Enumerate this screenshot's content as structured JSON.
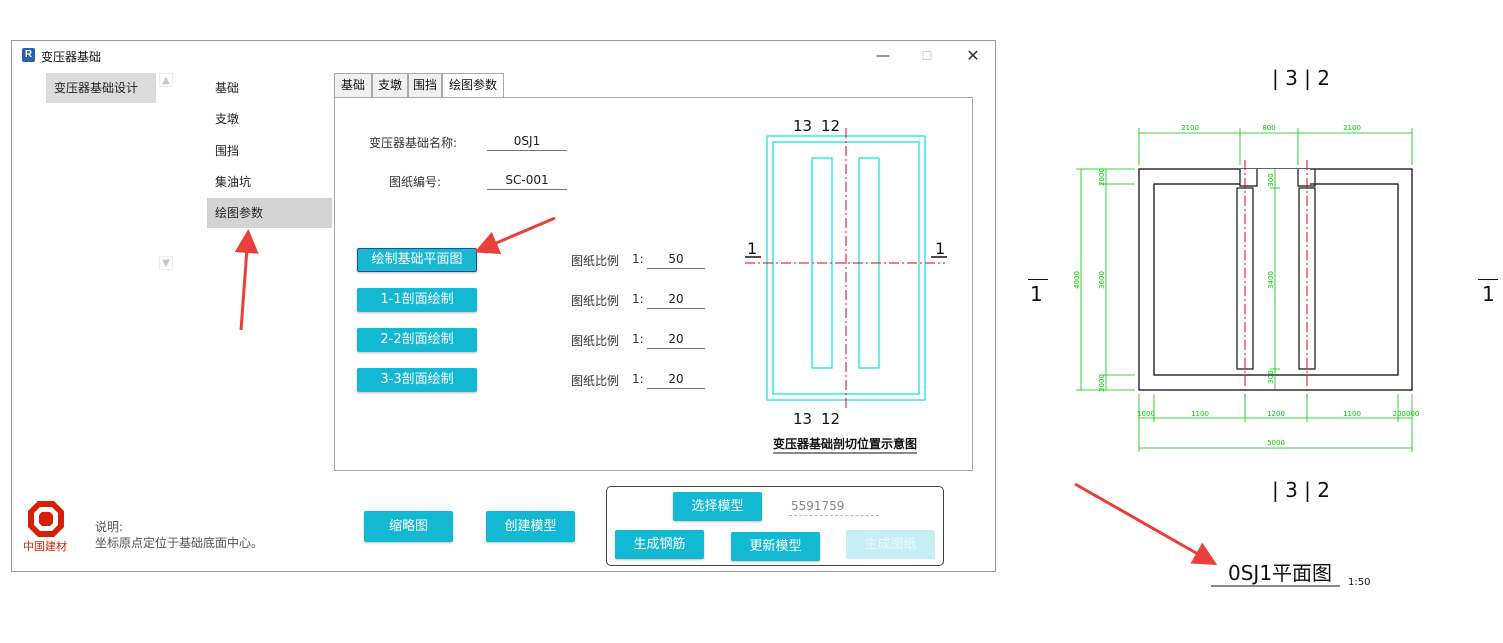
{
  "window": {
    "title": "变压器基础",
    "app_icon": "R",
    "controls": {
      "minimize": "—",
      "maximize": "☐",
      "close": "✕"
    }
  },
  "tree": {
    "item": "变压器基础设计",
    "scroll_up": "▲",
    "scroll_down": "▼"
  },
  "nav": {
    "items": [
      {
        "label": "基础"
      },
      {
        "label": "支墩"
      },
      {
        "label": "围挡"
      },
      {
        "label": "集油坑"
      },
      {
        "label": "绘图参数"
      }
    ],
    "active": 4
  },
  "tabs": [
    {
      "label": "基础"
    },
    {
      "label": "支墩"
    },
    {
      "label": "围挡"
    },
    {
      "label": "绘图参数"
    }
  ],
  "form": {
    "name_label": "变压器基础名称:",
    "name_value": "0SJ1",
    "number_label": "图纸编号:",
    "number_value": "SC-001"
  },
  "draw_rows": [
    {
      "button": "绘制基础平面图",
      "scale_label": "图纸比例",
      "prefix": "1:",
      "value": "50"
    },
    {
      "button": "1-1剖面绘制",
      "scale_label": "图纸比例",
      "prefix": "1:",
      "value": "20"
    },
    {
      "button": "2-2剖面绘制",
      "scale_label": "图纸比例",
      "prefix": "1:",
      "value": "20"
    },
    {
      "button": "3-3剖面绘制",
      "scale_label": "图纸比例",
      "prefix": "1:",
      "value": "20"
    }
  ],
  "preview": {
    "top_labels": [
      "13",
      "12"
    ],
    "bottom_labels": [
      "13",
      "12"
    ],
    "left_label": "1",
    "right_label": "1",
    "caption": "变压器基础剖切位置示意图"
  },
  "bottom": {
    "thumbnail_button": "缩略图",
    "create_model_button": "创建模型",
    "select_model_button": "选择模型",
    "model_id": "5591759",
    "rebar_button": "生成钢筋",
    "update_model_button": "更新模型",
    "drawing_button": "生成图纸"
  },
  "logo_text": "中国建材",
  "note": {
    "title": "说明:",
    "text": "坐标原点定位于基础底面中心。"
  },
  "drawing": {
    "section_top": "| 3 | 2",
    "section_bottom": "| 3 | 2",
    "left_mark": "1",
    "right_mark": "1",
    "top_dims": [
      "2100",
      "800",
      "2100"
    ],
    "bottom_dims": [
      "1100",
      "1200",
      "1100"
    ],
    "bottom_small_left": "1000",
    "bottom_small_right": "200000",
    "total_dim": "5000",
    "left_dims": [
      "4000",
      "3600"
    ],
    "left_small_top": "2000",
    "left_small_bottom": "2000",
    "inner_dims": [
      "300",
      "3400",
      "300"
    ],
    "title": "0SJ1平面图",
    "scale": "1:50"
  },
  "colors": {
    "button": "#13b9d2",
    "arrow": "#e8403a",
    "cyan": "#00e5ee",
    "dim": "#00c800",
    "axis": "#e0001b"
  }
}
